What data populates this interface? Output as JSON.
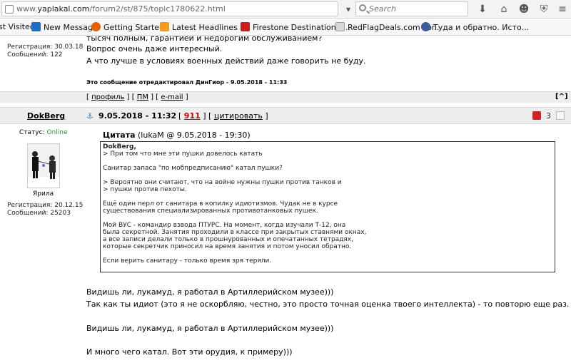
{
  "browser": {
    "url_prefix": "www.",
    "url_domain": "yaplakal.com",
    "url_path": "/forum2/st/875/topic1780622.html",
    "search_placeholder": "Search",
    "bookmarks": [
      {
        "label": "st Visited"
      },
      {
        "label": "New Message"
      },
      {
        "label": "Getting Started"
      },
      {
        "label": "Latest Headlines"
      },
      {
        "label": "Firestone Destination L..."
      },
      {
        "label": "RedFlagDeals.com For..."
      },
      {
        "label": "Туда и обратно. Исто..."
      }
    ]
  },
  "prev_post": {
    "lines": [
      "тысяч полным, гарантией и недорогим обслуживанием?",
      "Вопрос очень даже интересный.",
      "А что лучше в условиях военных действий даже говорить не буду."
    ],
    "edited_prefix": "Это сообщение отредактировал ",
    "edited_user": "ДинГиор",
    "edited_suffix": " - 9.05.2018 - 11:33",
    "reg_label": "Регистрация: 30.03.18",
    "msgs_label": "Сообщений: 122",
    "links": {
      "open": "[",
      "profile": "профиль",
      "sep1": "] [",
      "pm": "ПМ",
      "sep2": "] [",
      "email": "e-mail",
      "close": "]"
    },
    "up_label": "[^]"
  },
  "post": {
    "author": "DokBerg",
    "datetime": "9.05.2018 - 11:32",
    "rating_open": "[",
    "rating": "911",
    "rating_sep": "] [",
    "quote_label": "цитировать",
    "rating_close": "]",
    "status_label": "Статус:",
    "status_value": "Online",
    "avatar_caption": "Ярила",
    "reg_label": "Регистрация: 20.12.15",
    "msgs_label": "Сообщений: 25203",
    "report_count": "3",
    "quote_header": "Цитата",
    "quote_meta": "(lukaM @ 9.05.2018 - 19:30)",
    "quote_lines": [
      "DokBerg,",
      "> При том что мне эти пушки довелось катать",
      "",
      "Санитар запаса \"по мобпредписанию\" катал пушки?",
      "",
      "> Вероятно они считают, что на войне нужны пушки против танков и",
      "> пушки против пехоты.",
      "",
      "Ещё один перл от санитара в копилку идиотизмов. Чудак не в курсе",
      "существования специализированных противотанковых пушек.",
      "",
      "Мой ВУС - командир взвода ПТУРС. На момент, когда изучали Т-12, она",
      "была секретной. Занятия проходили в классе при закрытых ставнями окнах,",
      "а все записи делали только в прошнурованных и опечатанных тетрадях,",
      "которые секретчик приносил на время занятия и потом уносил обратно.",
      "",
      "Если верить санитару - только время зря теряли."
    ],
    "body_lines": [
      "Видишь ли, лукамуд, я работал в Артиллерийском музее)))",
      "Так как ты идиот (это я не оскорбляю, честно, это просто точная оценка твоего интеллекта) - то повторю еще раз.",
      "",
      "Видишь ли, лукамуд, я работал в Артиллерийском музее)))",
      "",
      "И много чего катал. Вот эти орудия, к примеру)))"
    ]
  }
}
